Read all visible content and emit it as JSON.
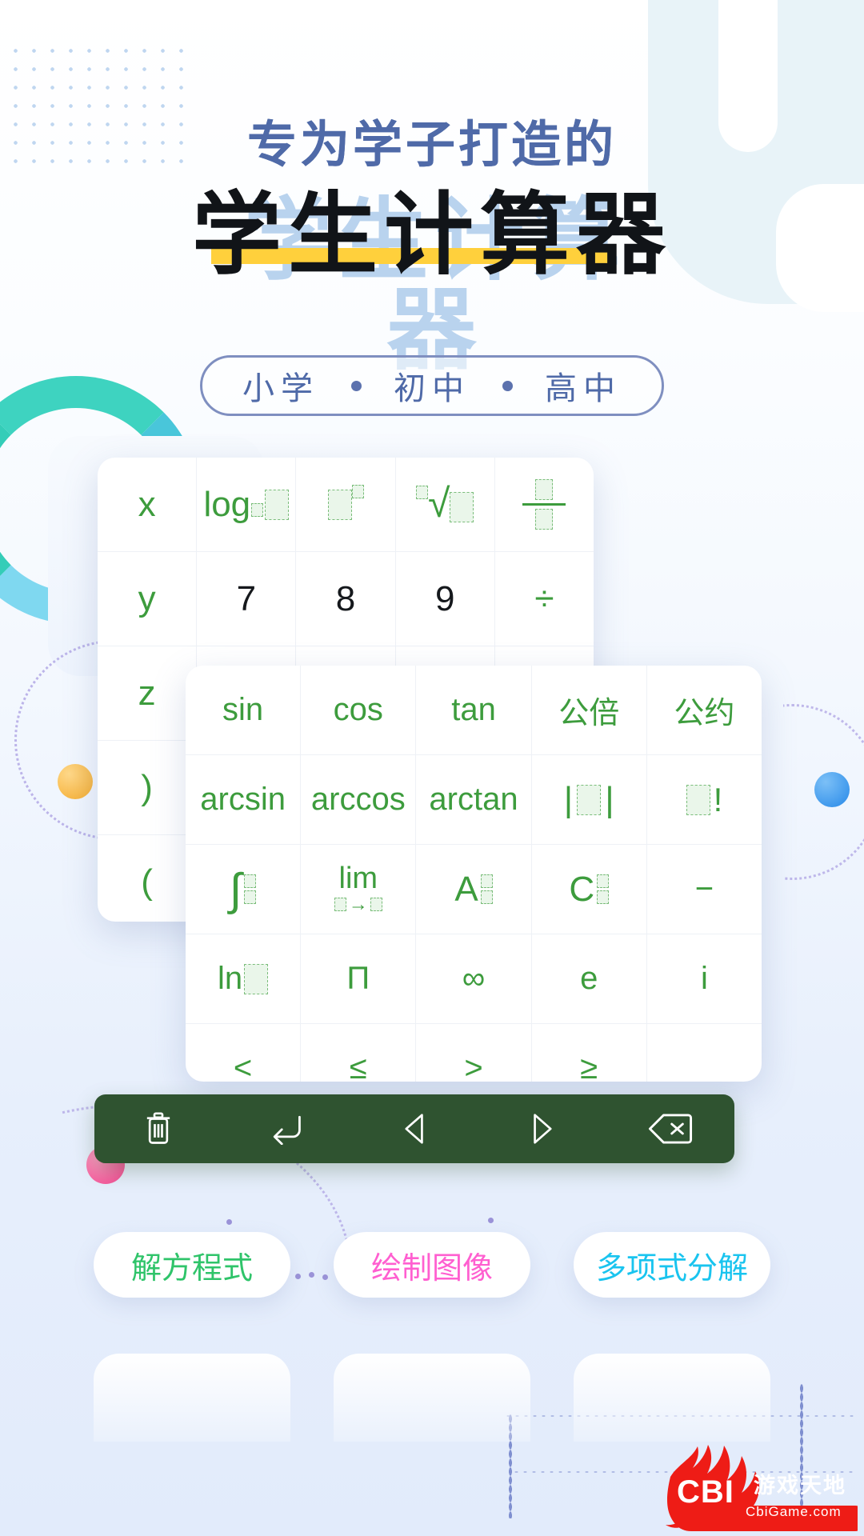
{
  "headline": {
    "sub": "专为学子打造的",
    "main": "学生计算器"
  },
  "grade_pill": {
    "items": [
      "小学",
      "初中",
      "高中"
    ],
    "separator": "•",
    "border_color": "#7f8fc0",
    "text_color": "#4f6aa8"
  },
  "keypad_back": {
    "rows": [
      [
        "x",
        "log",
        "power",
        "sqrt",
        "fraction"
      ],
      [
        "y",
        "7",
        "8",
        "9",
        "÷"
      ],
      [
        "z",
        "",
        "",
        "",
        ""
      ],
      [
        ")",
        "",
        "",
        "",
        ""
      ],
      [
        "(",
        "",
        "",
        "",
        ""
      ]
    ],
    "labels": {
      "x": "x",
      "y": "y",
      "z": "z",
      "paren_close": ")",
      "paren_open": "(",
      "log": "log",
      "div": "÷",
      "seven": "7",
      "eight": "8",
      "nine": "9"
    }
  },
  "keypad_front": {
    "rows": [
      [
        "sin",
        "cos",
        "tan",
        "公倍",
        "公约"
      ],
      [
        "arcsin",
        "arccos",
        "arctan",
        "abs",
        "factorial"
      ],
      [
        "integral",
        "lim",
        "A",
        "C",
        "−"
      ],
      [
        "ln",
        "Π",
        "∞",
        "e",
        "i"
      ],
      [
        "<",
        "≤",
        ">",
        "≥",
        ""
      ]
    ],
    "labels": {
      "sin": "sin",
      "cos": "cos",
      "tan": "tan",
      "gongbei": "公倍",
      "gongyue": "公约",
      "arcsin": "arcsin",
      "arccos": "arccos",
      "arctan": "arctan",
      "A": "A",
      "C": "C",
      "minus": "−",
      "ln": "ln",
      "pi_prod": "Π",
      "inf": "∞",
      "e": "e",
      "i": "i",
      "lt": "<",
      "le": "≤",
      "gt": ">",
      "ge": "≥",
      "lim": "lim",
      "arrow": "→",
      "factorial": "!"
    },
    "key_color": "#3d9c3d"
  },
  "toolbar": {
    "background": "#2f5330",
    "buttons": [
      {
        "name": "trash-icon",
        "label": "清除"
      },
      {
        "name": "enter-icon",
        "label": "换行"
      },
      {
        "name": "arrow-left-icon",
        "label": "左移"
      },
      {
        "name": "arrow-right-icon",
        "label": "右移"
      },
      {
        "name": "backspace-icon",
        "label": "退格"
      }
    ]
  },
  "chips": [
    {
      "label": "解方程式",
      "color": "#2fc46a"
    },
    {
      "label": "绘制图像",
      "color": "#ff5fd0"
    },
    {
      "label": "多项式分解",
      "color": "#19c4ef"
    }
  ],
  "watermark": {
    "brand": "CBI",
    "cn": "游戏天地",
    "url": "CbiGame.com",
    "color": "#ee1c16"
  }
}
